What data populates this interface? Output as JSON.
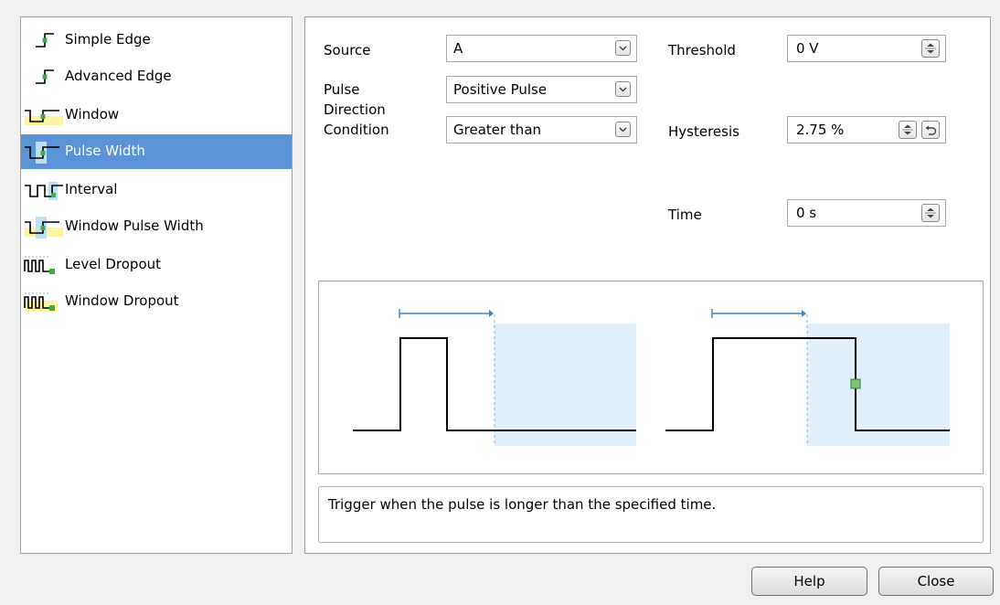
{
  "trigger_types": {
    "items": [
      {
        "label": "Simple Edge",
        "icon": "simple-edge-icon"
      },
      {
        "label": "Advanced Edge",
        "icon": "advanced-edge-icon"
      },
      {
        "label": "Window",
        "icon": "window-icon"
      },
      {
        "label": "Pulse Width",
        "icon": "pulse-width-icon",
        "selected": true
      },
      {
        "label": "Interval",
        "icon": "interval-icon"
      },
      {
        "label": "Window Pulse Width",
        "icon": "window-pulse-width-icon"
      },
      {
        "label": "Level Dropout",
        "icon": "level-dropout-icon"
      },
      {
        "label": "Window Dropout",
        "icon": "window-dropout-icon"
      }
    ]
  },
  "settings": {
    "source_label": "Source",
    "source_value": "A",
    "direction_label": "Pulse Direction",
    "direction_label_line1": "Pulse",
    "direction_label_line2": "Direction",
    "direction_value": "Positive Pulse",
    "condition_label": "Condition",
    "condition_value": "Greater than",
    "threshold_label": "Threshold",
    "threshold_value": "0 V",
    "hysteresis_label": "Hysteresis",
    "hysteresis_value": "2.75 %",
    "time_label": "Time",
    "time_value": "0 s"
  },
  "description": "Trigger when the pulse is longer than the specified time.",
  "buttons": {
    "help_label": "Help",
    "close_label": "Close"
  },
  "colors": {
    "selection": "#5b94d6",
    "trigger_zone": "#e1effa",
    "timing_marker": "#3e86c5",
    "trigger_point": "#7cc47a"
  }
}
